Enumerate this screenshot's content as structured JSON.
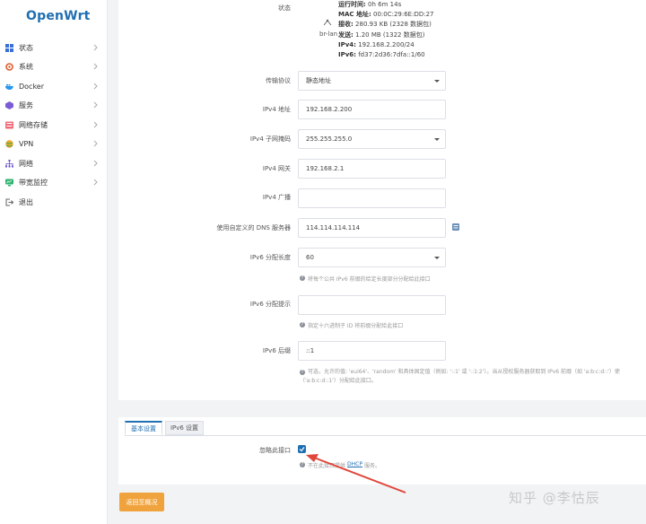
{
  "app": {
    "logo": "OpenWrt"
  },
  "sidebar": {
    "items": [
      {
        "label": "状态",
        "icon": "grid-icon"
      },
      {
        "label": "系统",
        "icon": "gear-icon"
      },
      {
        "label": "Docker",
        "icon": "docker-icon"
      },
      {
        "label": "服务",
        "icon": "cube-icon"
      },
      {
        "label": "网络存储",
        "icon": "storage-icon"
      },
      {
        "label": "VPN",
        "icon": "globe-icon"
      },
      {
        "label": "网络",
        "icon": "network-icon"
      },
      {
        "label": "带宽监控",
        "icon": "monitor-icon"
      },
      {
        "label": "退出",
        "icon": "logout-icon"
      }
    ]
  },
  "status": {
    "label": "状态",
    "iface": "br-lan",
    "uptime_label": "运行时间:",
    "uptime": "0h 6m 14s",
    "mac_label": "MAC 地址:",
    "mac": "00:0C:29:6E:DD:27",
    "rx_label": "接收:",
    "rx": "280.93 KB (2328 数据包)",
    "tx_label": "发送:",
    "tx": "1.20 MB (1322 数据包)",
    "ipv4_label": "IPv4:",
    "ipv4": "192.168.2.200/24",
    "ipv6_label": "IPv6:",
    "ipv6": "fd37:2d36:7dfa::1/60"
  },
  "form": {
    "protocol": {
      "label": "传输协议",
      "value": "静态地址"
    },
    "ipv4_addr": {
      "label": "IPv4 地址",
      "value": "192.168.2.200"
    },
    "ipv4_mask": {
      "label": "IPv4 子网掩码",
      "value": "255.255.255.0"
    },
    "ipv4_gw": {
      "label": "IPv4 网关",
      "value": "192.168.2.1"
    },
    "ipv4_bcast": {
      "label": "IPv4 广播",
      "value": ""
    },
    "dns": {
      "label": "使用自定义的 DNS 服务器",
      "value": "114.114.114.114"
    },
    "ipv6_len": {
      "label": "IPv6 分配长度",
      "value": "60",
      "hint": "将每个公共 IPv6 前缀的给定长度部分分配给此接口"
    },
    "ipv6_hint": {
      "label": "IPv6 分配提示",
      "value": "",
      "hint": "指定十六进制子 ID 将前缀分配给此接口"
    },
    "ipv6_suffix": {
      "label": "IPv6 后缀",
      "value": "::1",
      "hint1": "可选，允许的值: 'eui64'、'random' 和具体固定值（例如: '::1' 或 '::1:2'）。当从授权服务器获取到 IPv6 前缀（如 'a:b:c:d::'）使",
      "hint2": "（'a:b:c:d::1'）分配给此接口。"
    }
  },
  "tabs": {
    "basic": "基本设置",
    "ipv6": "IPv6 设置"
  },
  "dhcp": {
    "ignore_label": "忽略此接口",
    "hint_pre": "不在此接口提供",
    "hint_link": "DHCP",
    "hint_post": "服务。"
  },
  "actions": {
    "back": "返回至概况"
  },
  "watermark": "知乎 @李怙辰",
  "colors": {
    "accent": "#1f6fb2",
    "button": "#f0a33c",
    "annotation": "#e0463a"
  }
}
